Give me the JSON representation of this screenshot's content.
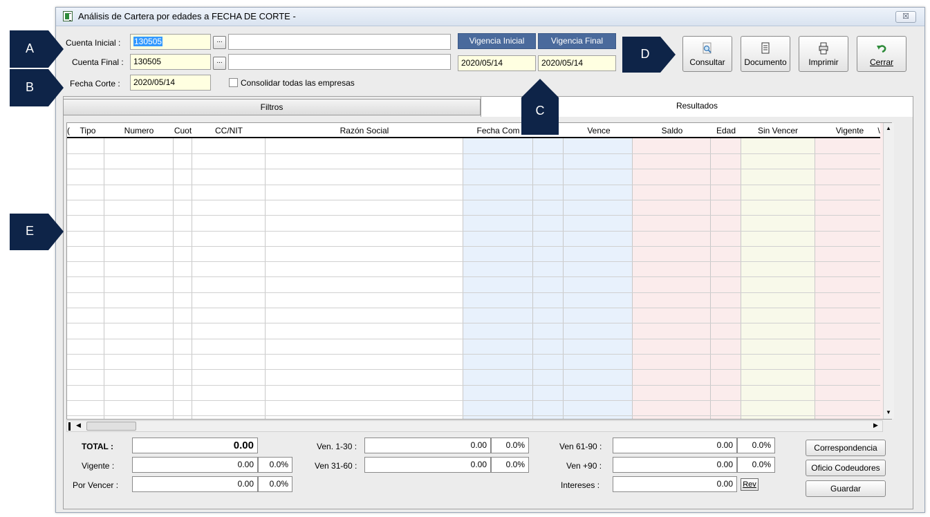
{
  "window": {
    "title": "Análisis de Cartera por edades a FECHA DE CORTE -",
    "close_glyph": "☒"
  },
  "form": {
    "cuenta_inicial": {
      "label": "Cuenta Inicial :",
      "value": "130505",
      "desc": ""
    },
    "cuenta_final": {
      "label": "Cuenta Final :",
      "value": "130505",
      "desc": ""
    },
    "fecha_corte": {
      "label": "Fecha Corte :",
      "value": "2020/05/14"
    },
    "consolidar_label": "Consolidar todas las empresas",
    "browse_glyph": "..."
  },
  "vigencia": {
    "inicial_label": "Vigencia Inicial",
    "inicial_value": "2020/05/14",
    "final_label": "Vigencia Final",
    "final_value": "2020/05/14"
  },
  "toolbar": {
    "consultar": "Consultar",
    "documento": "Documento",
    "imprimir": "Imprimir",
    "cerrar": "Cerrar"
  },
  "tabs": {
    "filtros": "Filtros",
    "resultados": "Resultados"
  },
  "grid": {
    "columns": [
      "(",
      "Tipo",
      "Numero",
      "Cuot",
      "CC/NIT",
      "Razón Social",
      "Fecha Com",
      "",
      "Vence",
      "Saldo",
      "Edad",
      "Sin Vencer",
      "Vigente",
      "\\"
    ]
  },
  "summary": {
    "total_label": "TOTAL :",
    "total_value": "0.00",
    "vigente_label": "Vigente :",
    "vigente_value": "0.00",
    "vigente_pct": "0.0%",
    "por_vencer_label": "Por Vencer :",
    "por_vencer_value": "0.00",
    "por_vencer_pct": "0.0%",
    "ven_1_30_label": "Ven. 1-30 :",
    "ven_1_30_value": "0.00",
    "ven_1_30_pct": "0.0%",
    "ven_31_60_label": "Ven 31-60 :",
    "ven_31_60_value": "0.00",
    "ven_31_60_pct": "0.0%",
    "ven_61_90_label": "Ven 61-90 :",
    "ven_61_90_value": "0.00",
    "ven_61_90_pct": "0.0%",
    "ven_90_label": "Ven +90 :",
    "ven_90_value": "0.00",
    "ven_90_pct": "0.0%",
    "intereses_label": "Intereses :",
    "intereses_value": "0.00",
    "rev_label": "Rev"
  },
  "side_buttons": {
    "correspondencia": "Correspondencia",
    "oficio": "Oficio Codeudores",
    "guardar": "Guardar"
  },
  "callouts": [
    "A",
    "B",
    "C",
    "D",
    "E"
  ],
  "colors": {
    "callout": "#0e2448",
    "field_yellow": "#ffffe1",
    "vigencia_header": "#4a6a9c",
    "col_blue": "#e8f1fc",
    "col_pink": "#fbecec",
    "col_yellow": "#f8f9ea"
  }
}
